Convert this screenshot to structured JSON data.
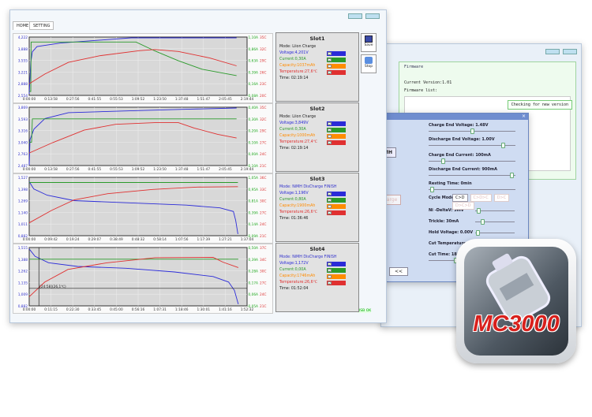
{
  "tabs": [
    {
      "label": "HOME"
    },
    {
      "label": "SETTING"
    }
  ],
  "buttons": {
    "save": "Save",
    "stop": "Stop"
  },
  "status": {
    "a": "USB",
    "b": "OK"
  },
  "slots": [
    {
      "title": "Slot1",
      "mode": "Mode: Liion  Charge",
      "voltage": "Voltage:4,201V",
      "current": "Current:0,30A",
      "capacity": "Capacity:1037mAh",
      "temperature": "Temperature:27,6℃",
      "time": "Time: 02:19:14",
      "checks": [
        true,
        true,
        false,
        true
      ]
    },
    {
      "title": "Slot2",
      "mode": "Mode: Liion  Charge",
      "voltage": "Voltage:3,849V",
      "current": "Current:0,30A",
      "capacity": "Capacity:1000mAh",
      "temperature": "Temperature:27,4℃",
      "time": "Time: 02:19:14",
      "checks": [
        true,
        true,
        false,
        true
      ]
    },
    {
      "title": "Slot3",
      "mode": "Mode: NiMH  DisCharge FINISH",
      "voltage": "Voltage:1,196V",
      "current": "Current:0,80A",
      "capacity": "Capacity:1900mAh",
      "temperature": "Temperature:26,6℃",
      "time": "Time: 01:36:46",
      "checks": [
        true,
        true,
        false,
        true
      ]
    },
    {
      "title": "Slot4",
      "mode": "Mode: NiMH  DisCharge FINISH",
      "voltage": "Voltage:1,172V",
      "current": "Current:0,00A",
      "capacity": "Capacity:1746mAh",
      "temperature": "Temperature:26,6℃",
      "time": "Time: 01:52:04",
      "checks": [
        true,
        true,
        false,
        true
      ]
    }
  ],
  "colors": {
    "voltage": "#2b2bd8",
    "current": "#2a9a2a",
    "capacity": "#ff8c00",
    "temperature": "#e03030"
  },
  "chart_data": [
    {
      "type": "line",
      "xmax": 138.7,
      "xticks": [
        "0:00:00",
        "0:13:58",
        "0:27:56",
        "0:41:55",
        "0:55:53",
        "1:09:52",
        "1:23:50",
        "1:37:48",
        "1:51:47",
        "2:05:45",
        "2:19:44"
      ],
      "yleft": [
        "4,222",
        "3,888",
        "3,555",
        "3,221",
        "2,888",
        "2,554"
      ],
      "ylim": [
        2.554,
        4.222
      ],
      "yright_i": [
        "1,10A",
        "0,86A",
        "0,63A",
        "0,39A",
        "0,16A",
        "-0,08A"
      ],
      "ilim": [
        -0.08,
        1.1
      ],
      "yright_t": [
        "35C",
        "32C",
        "29C",
        "26C",
        "23C",
        "20C"
      ],
      "tlim": [
        20,
        35
      ],
      "series": [
        {
          "name": "voltage",
          "pts": [
            [
              0,
              2.6
            ],
            [
              1,
              3.5
            ],
            [
              2,
              3.8
            ],
            [
              5,
              3.95
            ],
            [
              20,
              4.05
            ],
            [
              50,
              4.15
            ],
            [
              65,
              4.2
            ],
            [
              132,
              4.2
            ]
          ]
        },
        {
          "name": "current",
          "pts": [
            [
              0,
              0
            ],
            [
              1,
              0
            ],
            [
              1.2,
              1.0
            ],
            [
              68,
              1.0
            ],
            [
              80,
              0.82
            ],
            [
              95,
              0.62
            ],
            [
              110,
              0.45
            ],
            [
              132,
              0.32
            ]
          ]
        },
        {
          "name": "temperature",
          "pts": [
            [
              0,
              23
            ],
            [
              10,
              25.5
            ],
            [
              25,
              28.5
            ],
            [
              45,
              30.2
            ],
            [
              70,
              31.5
            ],
            [
              80,
              31.8
            ],
            [
              95,
              31.3
            ],
            [
              115,
              29.6
            ],
            [
              132,
              27.6
            ]
          ]
        }
      ]
    },
    {
      "type": "line",
      "xmax": 138.7,
      "xticks": [
        "0:00:00",
        "0:13:58",
        "0:27:56",
        "0:41:55",
        "0:55:53",
        "1:09:52",
        "1:23:50",
        "1:37:48",
        "1:51:47",
        "2:05:45",
        "2:19:44"
      ],
      "yleft": [
        "3,869",
        "3,593",
        "3,316",
        "3,040",
        "2,763",
        "2,487"
      ],
      "ylim": [
        2.487,
        3.869
      ],
      "yright_i": [
        "0,40A",
        "0,30A",
        "0,20A",
        "0,10A",
        "0,00A",
        "-0,10A"
      ],
      "ilim": [
        -0.1,
        0.4
      ],
      "yright_t": [
        "35C",
        "32C",
        "29C",
        "27C",
        "24C",
        "21C"
      ],
      "tlim": [
        21,
        35
      ],
      "series": [
        {
          "name": "voltage",
          "pts": [
            [
              0,
              2.5
            ],
            [
              0.5,
              3.1
            ],
            [
              3,
              3.35
            ],
            [
              10,
              3.6
            ],
            [
              25,
              3.74
            ],
            [
              60,
              3.78
            ],
            [
              100,
              3.82
            ],
            [
              132,
              3.85
            ]
          ]
        },
        {
          "name": "current",
          "pts": [
            [
              0,
              0.1
            ],
            [
              1.5,
              0.1
            ],
            [
              2,
              0.3
            ],
            [
              132,
              0.3
            ]
          ]
        },
        {
          "name": "temperature",
          "pts": [
            [
              0,
              24
            ],
            [
              15,
              26.5
            ],
            [
              35,
              29.5
            ],
            [
              55,
              30.9
            ],
            [
              80,
              31.3
            ],
            [
              95,
              31.3
            ],
            [
              105,
              30
            ],
            [
              120,
              28.5
            ],
            [
              132,
              27.6
            ]
          ]
        }
      ]
    },
    {
      "type": "line",
      "xmax": 97.07,
      "xticks": [
        "0:00:00",
        "0:09:42",
        "0:19:24",
        "0:29:07",
        "0:38:49",
        "0:48:32",
        "0:58:14",
        "1:07:56",
        "1:17:39",
        "1:27:21",
        "1:37:04"
      ],
      "yleft": [
        "1,527",
        "1,398",
        "1,269",
        "1,140",
        "1,011",
        "0,882"
      ],
      "ylim": [
        0.882,
        1.527
      ],
      "yright_i": [
        "1,05A",
        "0,95A",
        "0,81A",
        "0,39A",
        "0,14A",
        "-0,09A"
      ],
      "ilim": [
        -0.09,
        1.05
      ],
      "yright_t": [
        "36C",
        "33C",
        "30C",
        "27C",
        "24C",
        "21C"
      ],
      "tlim": [
        21,
        36
      ],
      "series": [
        {
          "name": "voltage",
          "pts": [
            [
              0,
              1.48
            ],
            [
              2,
              1.4
            ],
            [
              8,
              1.33
            ],
            [
              20,
              1.27
            ],
            [
              40,
              1.25
            ],
            [
              70,
              1.22
            ],
            [
              85,
              1.19
            ],
            [
              91,
              1.15
            ],
            [
              92,
              1.05
            ],
            [
              93,
              0.9
            ]
          ]
        },
        {
          "name": "current",
          "pts": [
            [
              0,
              0.95
            ],
            [
              93,
              0.95
            ]
          ]
        },
        {
          "name": "temperature",
          "pts": [
            [
              0,
              24.3
            ],
            [
              10,
              27.5
            ],
            [
              20,
              30.2
            ],
            [
              35,
              31.8
            ],
            [
              55,
              32.9
            ],
            [
              75,
              33.5
            ],
            [
              93,
              33.6
            ]
          ]
        }
      ]
    },
    {
      "type": "line",
      "xmax": 112.53,
      "xticks": [
        "0:00:00",
        "0:11:15",
        "0:22:30",
        "0:33:45",
        "0:45:00",
        "0:56:16",
        "1:07:31",
        "1:18:46",
        "1:30:01",
        "1:41:16",
        "1:52:32"
      ],
      "yleft": [
        "1,515",
        "1,388",
        "1,262",
        "1,135",
        "1,009",
        "0,882"
      ],
      "ylim": [
        0.882,
        1.515
      ],
      "yright_i": [
        "0,50A",
        "0,39A",
        "0,28A",
        "0,17A",
        "0,06A",
        "-0,05A"
      ],
      "ilim": [
        -0.05,
        0.5
      ],
      "yright_t": [
        "37C",
        "34C",
        "30C",
        "27C",
        "24C",
        "21C"
      ],
      "tlim": [
        21,
        37
      ],
      "series": [
        {
          "name": "voltage",
          "pts": [
            [
              0,
              1.5
            ],
            [
              3,
              1.42
            ],
            [
              10,
              1.35
            ],
            [
              25,
              1.31
            ],
            [
              50,
              1.29
            ],
            [
              75,
              1.25
            ],
            [
              95,
              1.2
            ],
            [
              103,
              1.14
            ],
            [
              106,
              1.05
            ],
            [
              108,
              0.9
            ]
          ]
        },
        {
          "name": "current",
          "pts": [
            [
              0,
              0.39
            ],
            [
              108,
              0.39
            ]
          ]
        },
        {
          "name": "temperature",
          "pts": [
            [
              0,
              23.5
            ],
            [
              8,
              27.5
            ],
            [
              20,
              31
            ],
            [
              40,
              32.8
            ],
            [
              65,
              34.2
            ],
            [
              95,
              34.3
            ],
            [
              100,
              33
            ],
            [
              108,
              31.5
            ]
          ]
        }
      ],
      "cursor": {
        "x": 5,
        "label": "[24:58](26,1℃)"
      }
    }
  ],
  "settings": {
    "charge_end_voltage": "Charge End Voltage:  1.48V",
    "charge_end_voltage_pct": 0.5,
    "discharge_end_voltage": "Discharge End Voltage:  1.00V",
    "discharge_end_voltage_pct": 0.88,
    "charge_end_current": "Charge End Current:  100mA",
    "charge_end_current_pct": 0.15,
    "discharge_end_current": "Discharge End Current:  900mA",
    "discharge_end_current_pct": 0.98,
    "resting_time": "Resting Time:  0min",
    "resting_time_pct": 0.02,
    "cycle_mode": "Cycle Mode:",
    "cycle_options": [
      "C>D",
      "C>D>C",
      "D>C",
      "D>C>D"
    ],
    "ni_delta": "Ni -DeltaV:  3mV",
    "ni_delta_pct": 0.05,
    "trickle": "Trickle:  30mA",
    "trickle_pct": 0.15,
    "hold_voltage": "Hold Voltage:  0.00V",
    "hold_voltage_pct": 0.03,
    "cut_temperature": "Cut Temperature:  45C",
    "cut_temperature_pct": 0.5,
    "cut_time": "Cut Time:  180min",
    "cut_time_pct": 0.3,
    "nav": "<<",
    "side_btn": "MH",
    "side_btn2": "harge"
  },
  "firmware": {
    "legend": "Firmware",
    "current_version": "Current Version:1.01",
    "list_label": "Firmware list:",
    "check_button": "Checking for new version"
  },
  "logo": {
    "text": "MC3000"
  }
}
